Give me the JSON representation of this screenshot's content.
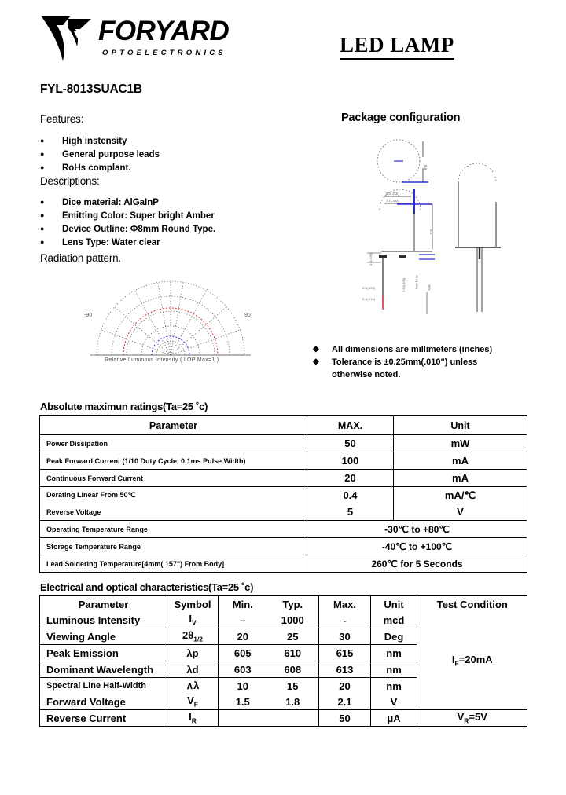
{
  "header": {
    "brand": "FORYARD",
    "brand_sub": "OPTOELECTRONICS",
    "doc_title": "LED LAMP",
    "part_number": "FYL-8013SUAC1B"
  },
  "features": {
    "label": "Features:",
    "items": [
      "High instensity",
      "General purpose leads",
      "RoHs complant."
    ]
  },
  "descriptions": {
    "label": "Descriptions:",
    "items": [
      "Dice material: AlGaInP",
      "Emitting Color: Super bright Amber",
      "Device Outline: Φ8mm Round Type.",
      "Lens Type: Water clear"
    ]
  },
  "radiation": {
    "label": "Radiation pattern.",
    "caption": "Relative Luminous Intensity ( LOP Max=1 )",
    "axis_left": "-90",
    "axis_right": "90"
  },
  "package": {
    "heading": "Package configuration",
    "notes": [
      "All dimensions are millimeters (inches)",
      "Tolerance  is   ±0.25mm(.010\")   unless otherwise noted."
    ]
  },
  "abs_max": {
    "title": "Absolute maximun ratings(Ta=25  ˚c)",
    "columns": [
      "Parameter",
      "MAX.",
      "Unit"
    ],
    "rows": [
      {
        "parameter": "Power Dissipation",
        "max": "50",
        "unit": "mW"
      },
      {
        "parameter": "Peak Forward Current (1/10 Duty Cycle, 0.1ms Pulse Width)",
        "max": "100",
        "unit": "mA"
      },
      {
        "parameter": "Continuous Forward Current",
        "max": "20",
        "unit": "mA"
      },
      {
        "parameter": "Derating Linear From 50℃",
        "max": "0.4",
        "unit": "mA/℃"
      },
      {
        "parameter": "Reverse Voltage",
        "max": "5",
        "unit": "V"
      }
    ],
    "span_rows": [
      {
        "parameter": "Operating Temperature Range",
        "value": "-30℃ to +80℃"
      },
      {
        "parameter": "Storage Temperature Range",
        "value": "-40℃ to +100℃"
      },
      {
        "parameter": "Lead Soldering Temperature[4mm(.157\") From Body]",
        "value": "260℃ for 5 Seconds"
      }
    ]
  },
  "elec_opt": {
    "title": "Electrical and optical characteristics(Ta=25  ˚c)",
    "columns": [
      "Parameter",
      "Symbol",
      "Min.",
      "Typ.",
      "Max.",
      "Unit",
      "Test Condition"
    ],
    "rows": [
      {
        "parameter": "Luminous Intensity",
        "symbol": "Iv",
        "min": "–",
        "typ": "1000",
        "max": "-",
        "unit": "mcd"
      },
      {
        "parameter": "Viewing Angle",
        "symbol": "2θ1/2",
        "min": "20",
        "typ": "25",
        "max": "30",
        "unit": "Deg"
      },
      {
        "parameter": "Peak Emission",
        "symbol": "λp",
        "min": "605",
        "typ": "610",
        "max": "615",
        "unit": "nm"
      },
      {
        "parameter": "Dominant Wavelength",
        "symbol": "λd",
        "min": "603",
        "typ": "608",
        "max": "613",
        "unit": "nm"
      },
      {
        "parameter": "Spectral Line Half-Width",
        "symbol": "∧λ",
        "min": "10",
        "typ": "15",
        "max": "20",
        "unit": "nm"
      },
      {
        "parameter": "Forward Voltage",
        "symbol": "VF",
        "min": "1.5",
        "typ": "1.8",
        "max": "2.1",
        "unit": "V"
      },
      {
        "parameter": "Reverse Current",
        "symbol": "IR",
        "min": "",
        "typ": "",
        "max": "50",
        "unit": "μA"
      }
    ],
    "test_condition_main": "IF=20mA",
    "test_condition_reverse": "VR=5V"
  },
  "colors": {
    "ink": "#000000",
    "dim_blue": "#0000cc",
    "dim_red": "#cc0000",
    "paper": "#ffffff"
  }
}
